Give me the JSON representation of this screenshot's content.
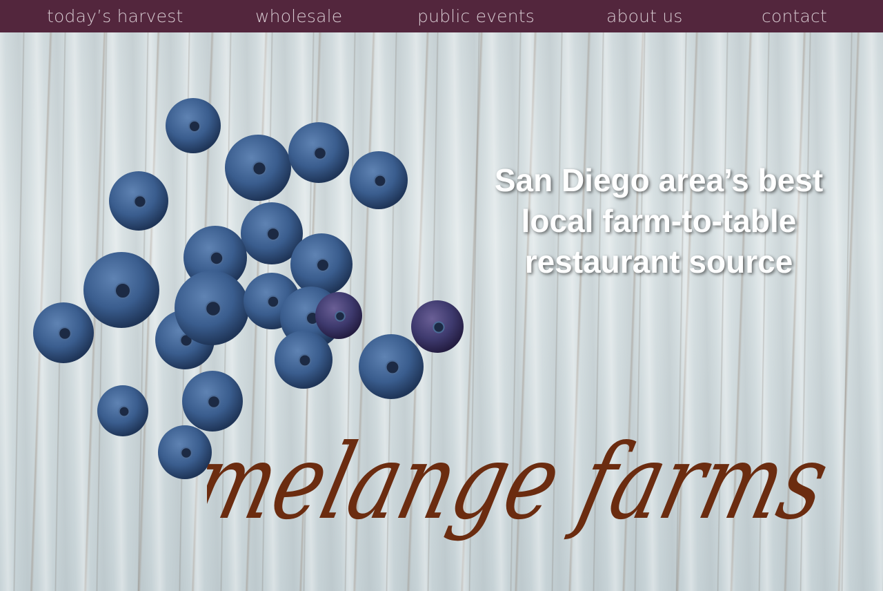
{
  "nav": {
    "items": [
      {
        "label": "today’s harvest"
      },
      {
        "label": "wholesale"
      },
      {
        "label": "public events"
      },
      {
        "label": "about us"
      },
      {
        "label": "contact"
      }
    ]
  },
  "hero": {
    "tagline_lines": [
      "San Diego area’s best",
      "local farm-to-table",
      "restaurant source"
    ],
    "logo_text": "melange farms"
  },
  "colors": {
    "nav_bg": "#53263d",
    "nav_text": "#d6c9d0",
    "logo": "#6b2c10"
  }
}
